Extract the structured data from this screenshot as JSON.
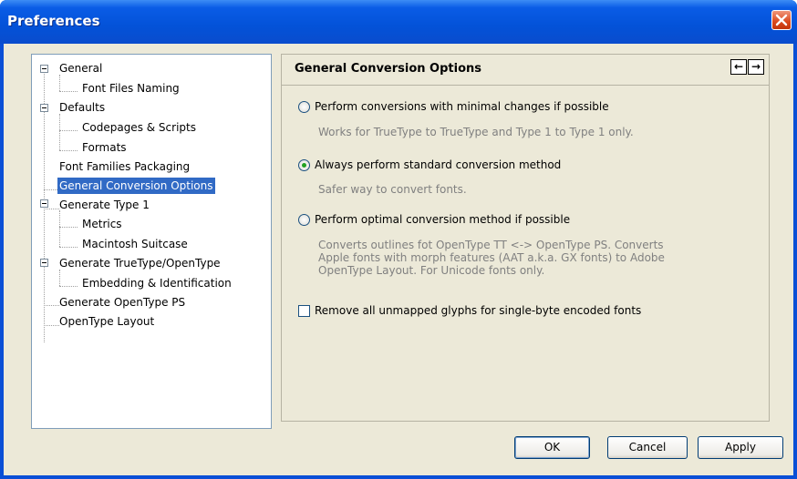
{
  "window": {
    "title": "Preferences"
  },
  "tree": {
    "items": [
      {
        "label": "General",
        "expandable": true
      },
      {
        "label": "Font Files Naming"
      },
      {
        "label": "Defaults",
        "expandable": true
      },
      {
        "label": "Codepages & Scripts"
      },
      {
        "label": "Formats"
      },
      {
        "label": "Font Families Packaging"
      },
      {
        "label": "General Conversion Options",
        "selected": true
      },
      {
        "label": "Generate Type 1",
        "expandable": true
      },
      {
        "label": "Metrics"
      },
      {
        "label": "Macintosh Suitcase"
      },
      {
        "label": "Generate TrueType/OpenType",
        "expandable": true
      },
      {
        "label": "Embedding & Identification"
      },
      {
        "label": "Generate OpenType PS"
      },
      {
        "label": "OpenType Layout"
      }
    ]
  },
  "panel": {
    "title": "General Conversion Options",
    "nav_back": "←",
    "nav_forward": "→",
    "options": [
      {
        "label": "Perform conversions with minimal changes if possible",
        "desc": "Works for TrueType to TrueType and Type 1 to Type 1 only.",
        "checked": false
      },
      {
        "label": "Always perform standard conversion method",
        "desc": "Safer way to convert fonts.",
        "checked": true
      },
      {
        "label": "Perform optimal conversion method if possible",
        "desc_lines": [
          "Converts outlines fot OpenType TT <-> OpenType PS. Converts",
          "Apple fonts with morph features (AAT a.k.a. GX fonts) to Adobe",
          "OpenType Layout. For Unicode fonts only."
        ],
        "checked": false
      }
    ],
    "checkbox": {
      "label": "Remove all unmapped glyphs for single-byte encoded fonts",
      "checked": false
    }
  },
  "buttons": {
    "ok": "OK",
    "cancel": "Cancel",
    "apply": "Apply"
  }
}
